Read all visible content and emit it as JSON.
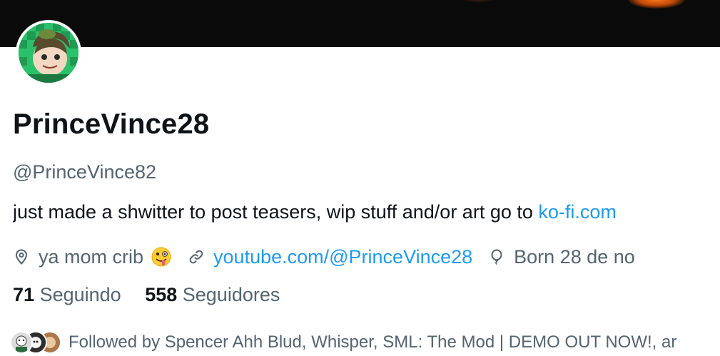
{
  "profile": {
    "display_name": "PrinceVince28",
    "handle": "@PrinceVince82",
    "bio_text": "just made a shwitter to post teasers, wip stuff and/or art go to ",
    "bio_link": "ko-fi.com",
    "location": "ya mom crib",
    "location_emoji": "zany-face-emoji",
    "website": "youtube.com/@PrinceVince28",
    "birthday": "Born 28 de no"
  },
  "stats": {
    "following_count": "71",
    "following_label": "Seguindo",
    "followers_count": "558",
    "followers_label": "Seguidores"
  },
  "followed_by": {
    "text": "Followed by Spencer Ahh Blud, Whisper, SML: The Mod | DEMO OUT NOW!, ar"
  },
  "colors": {
    "link": "#1d9bf0",
    "secondary_text": "#536471",
    "primary_text": "#0f1419",
    "banner": "#0a0a0a",
    "avatar_bg": "#27b863"
  },
  "icons": [
    "location-icon",
    "link-icon",
    "birthday-balloon-icon"
  ]
}
